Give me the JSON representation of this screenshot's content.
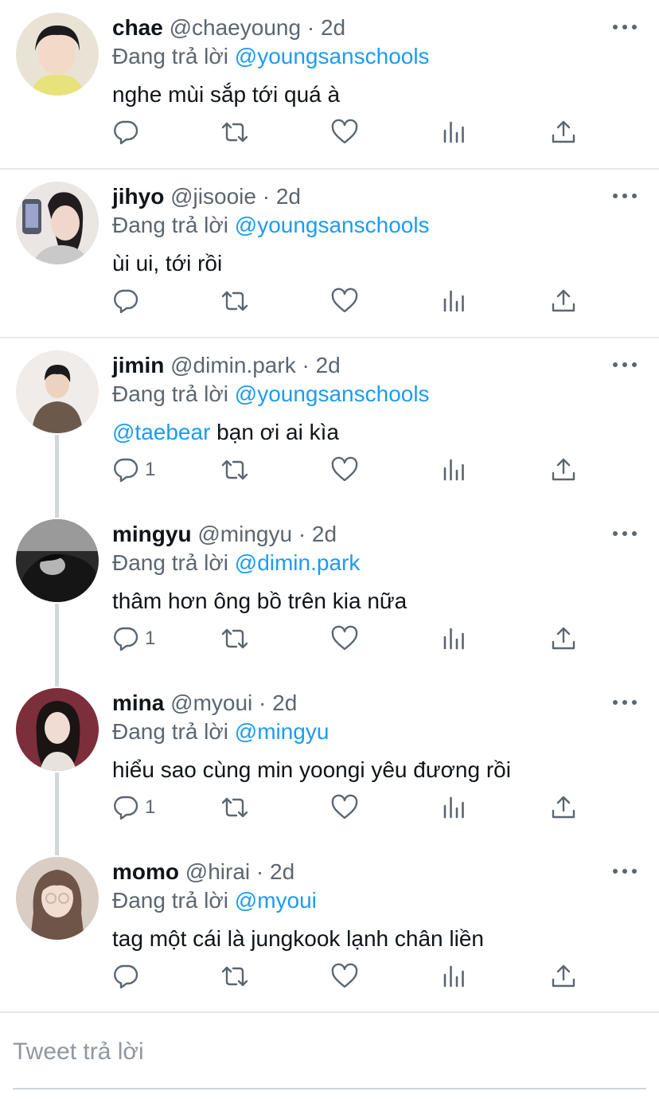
{
  "reply_prefix": "Đang trả lời",
  "dot": "·",
  "tweets": [
    {
      "name": "chae",
      "handle": "@chaeyoung",
      "time": "2d",
      "replying_to": "@youngsanschools",
      "text": "nghe mùi sắp tới quá à",
      "text_mention": "",
      "reply_count": ""
    },
    {
      "name": "jihyo",
      "handle": "@jisooie",
      "time": "2d",
      "replying_to": "@youngsanschools",
      "text": "ùi ui, tới rồi",
      "text_mention": "",
      "reply_count": ""
    },
    {
      "name": "jimin",
      "handle": "@dimin.park",
      "time": "2d",
      "replying_to": "@youngsanschools",
      "text": " bạn ơi ai kìa",
      "text_mention": "@taebear",
      "reply_count": "1"
    },
    {
      "name": "mingyu",
      "handle": "@mingyu",
      "time": "2d",
      "replying_to": "@dimin.park",
      "text": "thâm hơn ông bồ trên kia nữa",
      "text_mention": "",
      "reply_count": "1"
    },
    {
      "name": "mina",
      "handle": " @myoui",
      "time": "2d",
      "replying_to": "@mingyu",
      "text": "hiểu sao cùng min yoongi yêu đương rồi",
      "text_mention": "",
      "reply_count": "1"
    },
    {
      "name": "momo",
      "handle": "@hirai",
      "time": "2d",
      "replying_to": "@myoui",
      "text": "tag một cái là jungkook lạnh chân liền",
      "text_mention": "",
      "reply_count": ""
    }
  ],
  "reply_input": {
    "placeholder": "Tweet trả lời",
    "value": ""
  },
  "colors": {
    "link": "#1d9bf0",
    "secondary": "#5b6670",
    "divider": "#e6e9eb",
    "thread_line": "#d2d7db"
  },
  "icons": [
    "reply-icon",
    "retweet-icon",
    "like-icon",
    "analytics-icon",
    "share-icon",
    "more-icon"
  ]
}
